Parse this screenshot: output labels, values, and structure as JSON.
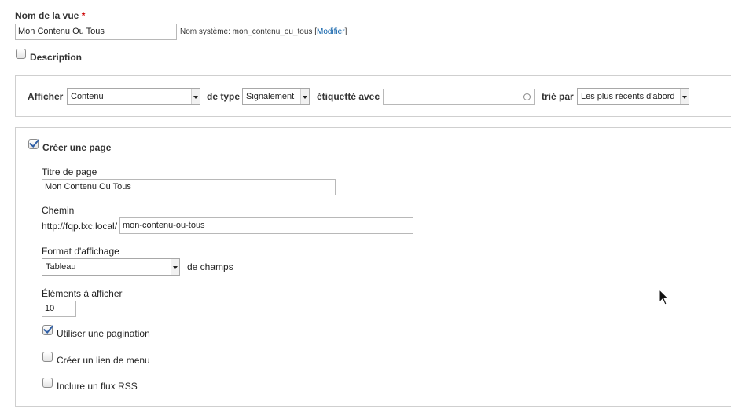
{
  "view_name": {
    "label": "Nom de la vue",
    "required_marker": "*",
    "value": "Mon Contenu Ou Tous",
    "system_name_prefix": "Nom système: mon_contenu_ou_tous [",
    "modify_link": "Modifier",
    "system_name_suffix": "]"
  },
  "description": {
    "label": "Description",
    "checked": false
  },
  "show_bar": {
    "show_label": "Afficher",
    "show_value": "Contenu",
    "type_label": "de type",
    "type_value": "Signalement",
    "tagged_label": "étiquetté avec",
    "tagged_value": "",
    "sorted_label": "trié par",
    "sorted_value": "Les plus récents d'abord"
  },
  "page": {
    "create_label": "Créer une page",
    "create_checked": true,
    "title_label": "Titre de page",
    "title_value": "Mon Contenu Ou Tous",
    "path_label": "Chemin",
    "path_prefix": "http://fqp.lxc.local/",
    "path_value": "mon-contenu-ou-tous",
    "format_label": "Format d'affichage",
    "format_value": "Tableau",
    "format_suffix": "de champs",
    "items_label": "Éléments à afficher",
    "items_value": "10",
    "pager_label": "Utiliser une pagination",
    "pager_checked": true,
    "menu_label": "Créer un lien de menu",
    "menu_checked": false,
    "rss_label": "Inclure un flux RSS",
    "rss_checked": false
  },
  "icons": {
    "cursor": "mouse-pointer-icon",
    "clear": "clear-circle-icon",
    "dropdown": "dropdown-arrow-icon"
  }
}
